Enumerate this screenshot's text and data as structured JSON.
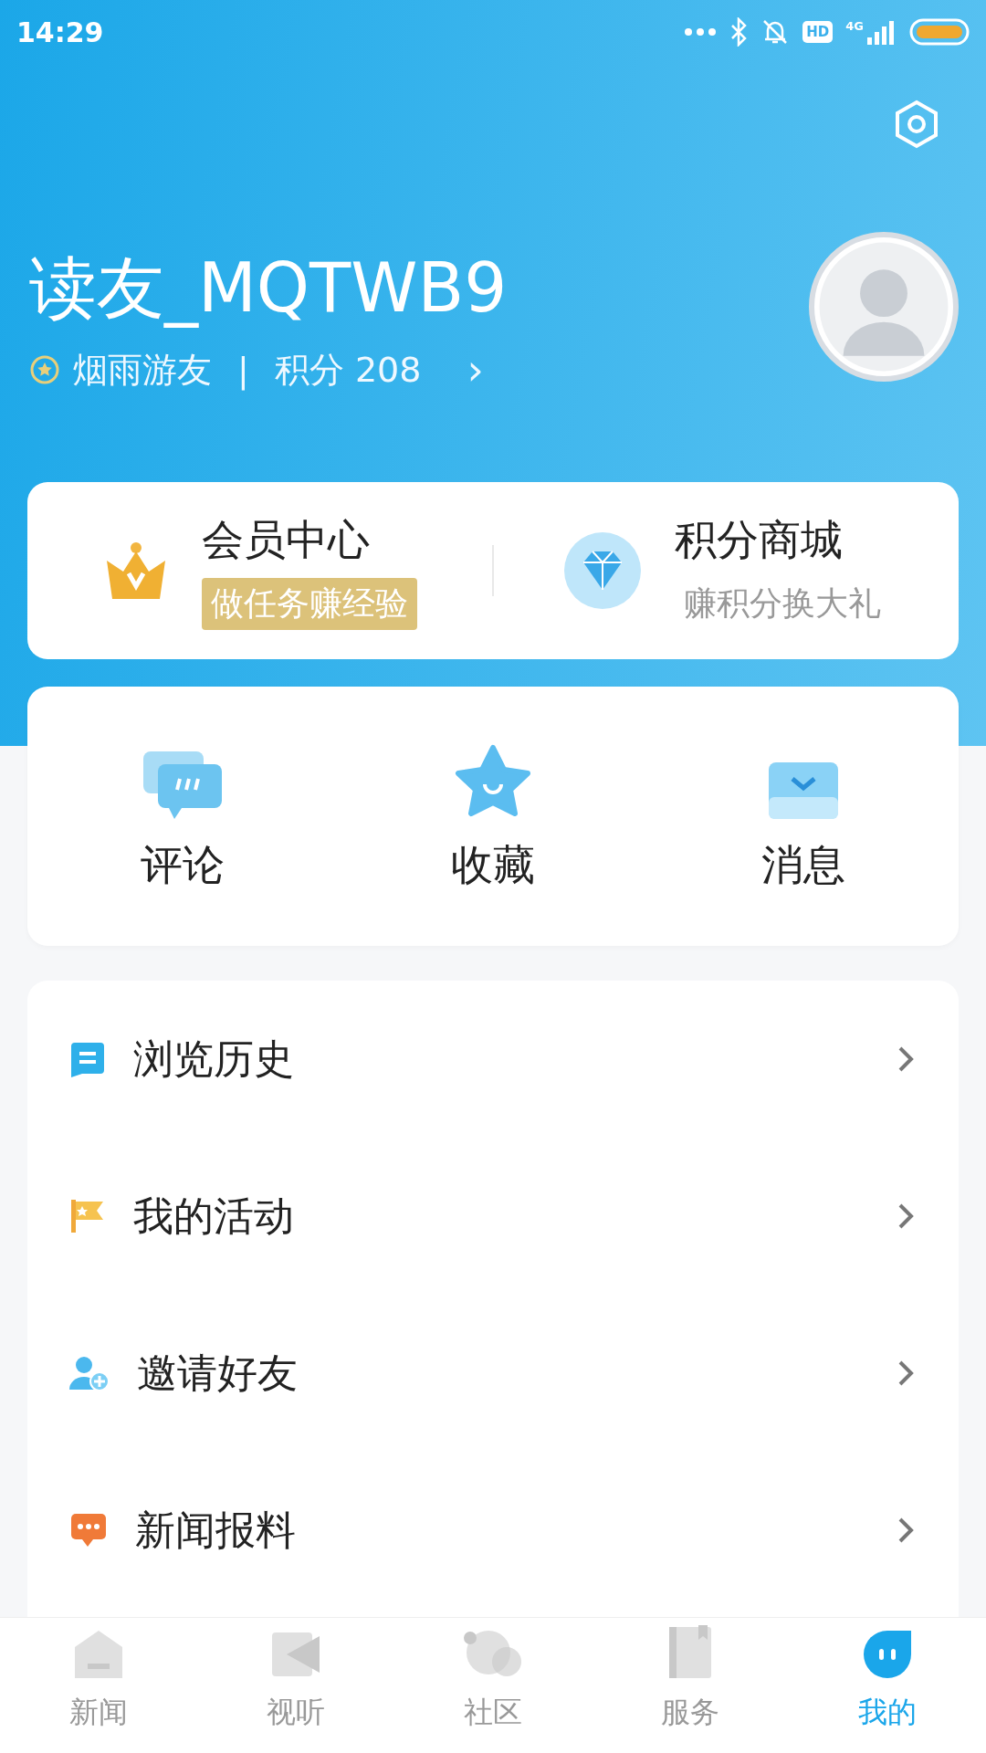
{
  "status_bar": {
    "time": "14:29",
    "hd_label": "HD",
    "network": "4G"
  },
  "profile": {
    "name": "读友_MQTWB9",
    "level": "烟雨游友",
    "separator": "|",
    "points": "积分 208",
    "arrow": "›"
  },
  "perks": [
    {
      "kind": "member",
      "title": "会员中心",
      "subtitle": "做任务赚经验",
      "highlight": true
    },
    {
      "kind": "mall",
      "title": "积分商城",
      "subtitle": "赚积分换大礼",
      "highlight": false
    }
  ],
  "shortcuts": [
    {
      "kind": "comment",
      "label": "评论"
    },
    {
      "kind": "favorite",
      "label": "收藏"
    },
    {
      "kind": "message",
      "label": "消息"
    }
  ],
  "menu": [
    {
      "kind": "history",
      "label": "浏览历史"
    },
    {
      "kind": "activity",
      "label": "我的活动"
    },
    {
      "kind": "invite",
      "label": "邀请好友"
    },
    {
      "kind": "report",
      "label": "新闻报料"
    }
  ],
  "tabs": [
    {
      "kind": "news",
      "label": "新闻",
      "selected": false
    },
    {
      "kind": "video",
      "label": "视听",
      "selected": false
    },
    {
      "kind": "community",
      "label": "社区",
      "selected": false
    },
    {
      "kind": "service",
      "label": "服务",
      "selected": false
    },
    {
      "kind": "mine",
      "label": "我的",
      "selected": true
    }
  ]
}
